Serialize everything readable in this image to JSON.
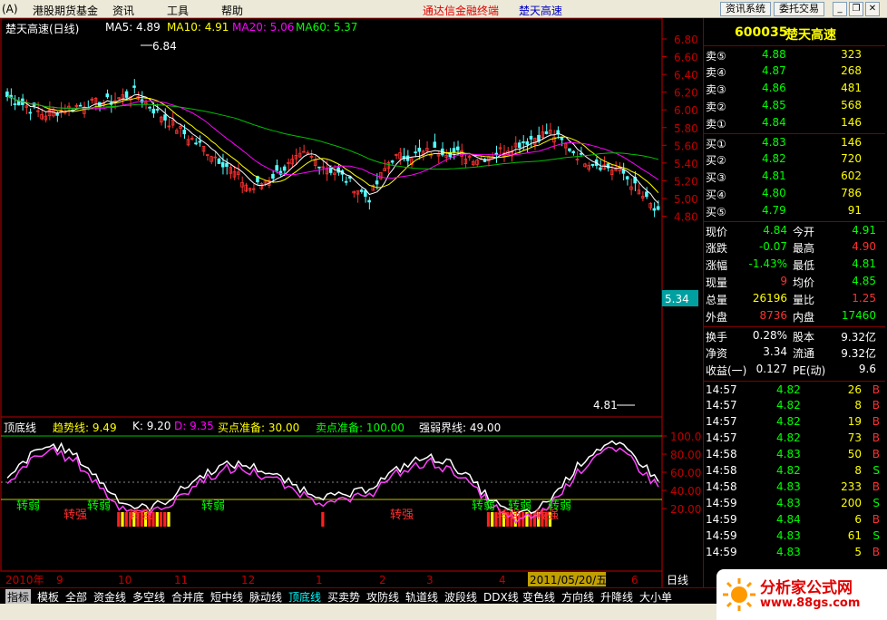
{
  "menu": {
    "items": [
      "(A)",
      "港股期货基金",
      "资讯",
      "工具",
      "帮助"
    ],
    "banner_left": "通达信金融终端",
    "banner_right": "楚天高速",
    "btn_news": "资讯系统",
    "btn_trade": "委托交易"
  },
  "chart": {
    "title": "楚天高速(日线)",
    "ma5": "MA5: 4.89",
    "ma10": "MA10: 4.91",
    "ma20": "MA20: 5.06",
    "ma60": "MA60: 5.37",
    "high_label": "6.84",
    "low_label": "4.81",
    "current_price_tag": "5.34",
    "price_axis": [
      "6.80",
      "6.60",
      "6.40",
      "6.20",
      "6.00",
      "5.80",
      "5.60",
      "5.40",
      "5.20",
      "5.00",
      "4.80"
    ],
    "indicator_axis": [
      "100.0",
      "80.00",
      "60.00",
      "40.00",
      "20.00"
    ],
    "date_labels": [
      "2010年",
      "9",
      "10",
      "11",
      "12",
      "1",
      "2",
      "3",
      "4",
      "5",
      "6"
    ],
    "date_highlight": "2011/05/20/五",
    "period": "日线",
    "colors": {
      "up": "#ff3232",
      "down": "#54ffff",
      "ma5": "#ffffff",
      "ma10": "#ffff00",
      "ma20": "#ff00ff",
      "ma60": "#00c000"
    }
  },
  "chart_data": {
    "type": "line",
    "title": "楚天高速(日线)",
    "ylim": [
      4.7,
      6.9
    ],
    "high": 6.84,
    "low": 4.81,
    "series": [
      {
        "name": "MA5",
        "last": 4.89
      },
      {
        "name": "MA10",
        "last": 4.91
      },
      {
        "name": "MA20",
        "last": 5.06
      },
      {
        "name": "MA60",
        "last": 5.37
      }
    ]
  },
  "indicator": {
    "name": "顶底线",
    "trend": "趋势线: 9.49",
    "k": "K: 9.20",
    "d": "D: 9.35",
    "buy_ready": "买点准备: 30.00",
    "sell_ready": "卖点准备: 100.00",
    "boundary": "强弱界线: 49.00",
    "labels": [
      {
        "t": "转弱",
        "c": "#00ff00"
      },
      {
        "t": "转强",
        "c": "#ff3030"
      },
      {
        "t": "转弱",
        "c": "#00ff00"
      },
      {
        "t": "转强",
        "c": "#ff3030"
      },
      {
        "t": "转弱",
        "c": "#00ff00"
      },
      {
        "t": "转强",
        "c": "#ff3030"
      },
      {
        "t": "转弱",
        "c": "#00ff00"
      },
      {
        "t": "转强",
        "c": "#ff3030"
      },
      {
        "t": "转弱",
        "c": "#00ff00"
      },
      {
        "t": "转强",
        "c": "#ff3030"
      },
      {
        "t": "转弱",
        "c": "#00ff00"
      }
    ]
  },
  "quote": {
    "code": "600035",
    "name": "楚天高速",
    "asks": [
      {
        "label": "卖⑤",
        "price": "4.88",
        "vol": "323"
      },
      {
        "label": "卖④",
        "price": "4.87",
        "vol": "268"
      },
      {
        "label": "卖③",
        "price": "4.86",
        "vol": "481"
      },
      {
        "label": "卖②",
        "price": "4.85",
        "vol": "568"
      },
      {
        "label": "卖①",
        "price": "4.84",
        "vol": "146"
      }
    ],
    "bids": [
      {
        "label": "买①",
        "price": "4.83",
        "vol": "146"
      },
      {
        "label": "买②",
        "price": "4.82",
        "vol": "720"
      },
      {
        "label": "买③",
        "price": "4.81",
        "vol": "602"
      },
      {
        "label": "买④",
        "price": "4.80",
        "vol": "786"
      },
      {
        "label": "买⑤",
        "price": "4.79",
        "vol": "91"
      }
    ],
    "stats": [
      {
        "l1": "现价",
        "v1": "4.84",
        "c1": "#00ff00",
        "l2": "今开",
        "v2": "4.91",
        "c2": "#00ff00"
      },
      {
        "l1": "涨跌",
        "v1": "-0.07",
        "c1": "#00ff00",
        "l2": "最高",
        "v2": "4.90",
        "c2": "#ff3030"
      },
      {
        "l1": "涨幅",
        "v1": "-1.43%",
        "c1": "#00ff00",
        "l2": "最低",
        "v2": "4.81",
        "c2": "#00ff00"
      },
      {
        "l1": "现量",
        "v1": "9",
        "c1": "#ff3030",
        "l2": "均价",
        "v2": "4.85",
        "c2": "#00ff00"
      },
      {
        "l1": "总量",
        "v1": "26196",
        "c1": "#ffff00",
        "l2": "量比",
        "v2": "1.25",
        "c2": "#ff3030"
      },
      {
        "l1": "外盘",
        "v1": "8736",
        "c1": "#ff3030",
        "l2": "内盘",
        "v2": "17460",
        "c2": "#00ff00"
      }
    ],
    "stats2": [
      {
        "l1": "换手",
        "v1": "0.28%",
        "l2": "股本",
        "v2": "9.32亿"
      },
      {
        "l1": "净资",
        "v1": "3.34",
        "l2": "流通",
        "v2": "9.32亿"
      },
      {
        "l1": "收益(一)",
        "v1": "0.127",
        "l2": "PE(动)",
        "v2": "9.6"
      }
    ],
    "ticks": [
      {
        "t": "14:57",
        "p": "4.82",
        "v": "26",
        "s": "B"
      },
      {
        "t": "14:57",
        "p": "4.82",
        "v": "8",
        "s": "B"
      },
      {
        "t": "14:57",
        "p": "4.82",
        "v": "19",
        "s": "B"
      },
      {
        "t": "14:57",
        "p": "4.82",
        "v": "73",
        "s": "B"
      },
      {
        "t": "14:58",
        "p": "4.83",
        "v": "50",
        "s": "B"
      },
      {
        "t": "14:58",
        "p": "4.82",
        "v": "8",
        "s": "S"
      },
      {
        "t": "14:58",
        "p": "4.83",
        "v": "233",
        "s": "B"
      },
      {
        "t": "14:59",
        "p": "4.83",
        "v": "200",
        "s": "S"
      },
      {
        "t": "14:59",
        "p": "4.84",
        "v": "6",
        "s": "B"
      },
      {
        "t": "14:59",
        "p": "4.83",
        "v": "61",
        "s": "S"
      },
      {
        "t": "14:59",
        "p": "4.83",
        "v": "5",
        "s": "B"
      }
    ]
  },
  "tabs": [
    "指标",
    "模板",
    "全部",
    "资金线",
    "多空线",
    "合并底",
    "短中线",
    "脉动线",
    "顶底线",
    "买卖势",
    "攻防线",
    "轨道线",
    "波段线",
    "DDX线",
    "变色线",
    "方向线",
    "升降线",
    "大小单"
  ],
  "logo": {
    "text": "分析家公式网",
    "url": "www.88gs.com"
  }
}
